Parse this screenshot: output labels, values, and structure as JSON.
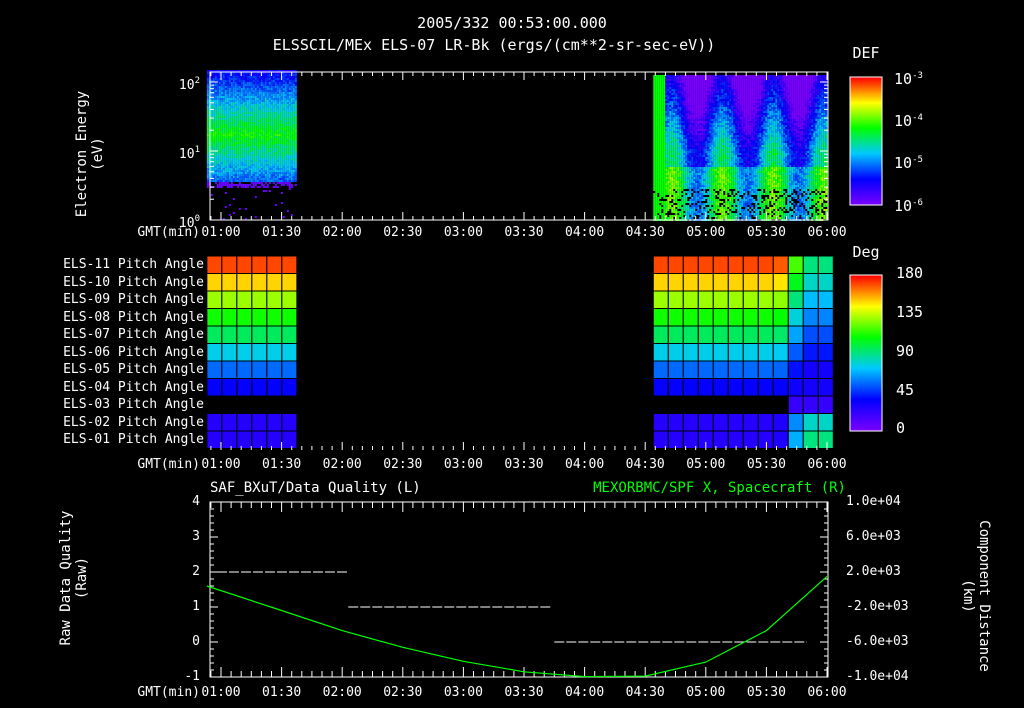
{
  "header": {
    "datetime": "2005/332 00:53:00.000"
  },
  "time_axis": {
    "label": "GMT(min)",
    "ticks": [
      "01:00",
      "01:30",
      "02:00",
      "02:30",
      "03:00",
      "03:30",
      "04:00",
      "04:30",
      "05:00",
      "05:30",
      "06:00"
    ]
  },
  "chart_data": [
    {
      "type": "heatmap",
      "title": "ELSSCIL/MEx ELS-07 LR-Bk  (ergs/(cm**2-sr-sec-eV))",
      "ylabel": "Electron Energy",
      "yunit": "(eV)",
      "yscale": "log",
      "ylim": [
        1,
        140
      ],
      "ytick_base": "10",
      "yticks": [
        "0",
        "1",
        "2"
      ],
      "xlim": [
        "00:53",
        "06:01"
      ],
      "data_intervals": [
        [
          "00:53",
          "01:37"
        ],
        [
          "04:34",
          "06:00"
        ]
      ],
      "colorbar": {
        "title": "DEF",
        "base": "10",
        "exponents": [
          "-3",
          "-4",
          "-5",
          "-6"
        ],
        "range": [
          1e-06,
          0.001
        ]
      }
    },
    {
      "type": "heatmap",
      "title": "Pitch Angle",
      "rows": [
        "ELS-11 Pitch Angle",
        "ELS-10 Pitch Angle",
        "ELS-09 Pitch Angle",
        "ELS-08 Pitch Angle",
        "ELS-07 Pitch Angle",
        "ELS-06 Pitch Angle",
        "ELS-05 Pitch Angle",
        "ELS-04 Pitch Angle",
        "ELS-03 Pitch Angle",
        "ELS-02 Pitch Angle",
        "ELS-01 Pitch Angle"
      ],
      "row_values_deg": [
        170,
        150,
        130,
        110,
        95,
        75,
        55,
        35,
        null,
        25,
        25
      ],
      "data_intervals": [
        [
          "00:53",
          "01:37"
        ],
        [
          "04:34",
          "05:58"
        ]
      ],
      "colorbar": {
        "title": "Deg",
        "ticks": [
          "180",
          "135",
          "90",
          "45",
          "0"
        ],
        "range": [
          0,
          180
        ]
      }
    },
    {
      "type": "line",
      "left_title": "SAF_BXuT/Data Quality (L)",
      "right_title": "MEXORBMC/SPF X, Spacecraft (R)",
      "left_ylabel": "Raw Data Quality",
      "left_yunit": "(Raw)",
      "right_ylabel": "Component Distance",
      "right_yunit": "(km)",
      "left_ylim": [
        -1,
        4
      ],
      "left_yticks": [
        "4",
        "3",
        "2",
        "1",
        "0",
        "-1"
      ],
      "right_ylim": [
        -10000,
        10000
      ],
      "right_yticks": [
        "1.0e+04",
        "6.0e+03",
        "2.0e+03",
        "-2.0e+03",
        "-6.0e+03",
        "-1.0e+04"
      ],
      "series": [
        {
          "name": "Data Quality",
          "color": "#ffffff",
          "segments": [
            {
              "from": "00:58",
              "to": "02:03",
              "value": 2
            },
            {
              "from": "02:03",
              "to": "03:44",
              "value": 1
            },
            {
              "from": "03:45",
              "to": "05:50",
              "value": 0
            }
          ]
        },
        {
          "name": "SPF X",
          "color": "#00ff00",
          "x_min": [
            53,
            90,
            120,
            150,
            180,
            210,
            240,
            270,
            300,
            330,
            360
          ],
          "y_km": [
            400,
            -2400,
            -4700,
            -6600,
            -8200,
            -9400,
            -9950,
            -9900,
            -8300,
            -4700,
            1500
          ]
        }
      ]
    }
  ]
}
